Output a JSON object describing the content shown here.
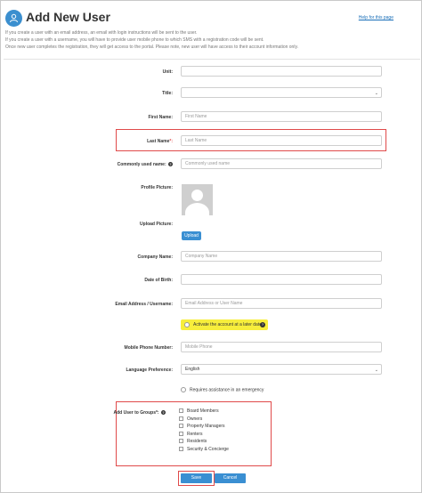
{
  "header": {
    "title": "Add New User",
    "help_link": "Help for this page",
    "intro_lines": [
      "If you create a user with an email address, an email with login instructions will be sent to the user.",
      "If you create a user with a username, you will have to provide user mobile phone to which SMS with a registration code will be sent.",
      "Once new user completes the registration, they will get access to the portal. Please note, new user will have access to their account information only."
    ]
  },
  "form": {
    "unit_label": "Unit:",
    "title_label": "Title:",
    "first_name_label": "First Name:",
    "first_name_placeholder": "First Name",
    "last_name_label": "Last Name",
    "last_name_required": "*:",
    "last_name_placeholder": "Last Name",
    "commonly_used_name_label": "Commonly used name:",
    "commonly_used_name_placeholder": "Commonly used name",
    "profile_picture_label": "Profile Picture:",
    "upload_picture_label": "Upload Picture:",
    "upload_button": "Upload",
    "company_name_label": "Company Name:",
    "company_name_placeholder": "Company Name",
    "date_of_birth_label": "Date of Birth:",
    "email_label": "Email Address / Username:",
    "email_placeholder": "Email Address or User Name",
    "activate_later_label": "Activate the account at a later date",
    "mobile_phone_label": "Mobile Phone Number:",
    "mobile_phone_placeholder": "Mobile Phone",
    "language_label": "Language Preference:",
    "language_value": "English",
    "assistance_label": "Requires assistance in an emergency",
    "groups_label": "Add User to Groups*:",
    "groups": [
      "Board Members",
      "Owners",
      "Property Managers",
      "Renters",
      "Residents",
      "Security & Concierge"
    ],
    "save_button": "Save",
    "cancel_button": "Cancel"
  },
  "colors": {
    "accent": "#3a8fd2",
    "highlight_border": "#e04a4a",
    "yellow_highlight": "#f7ee3c"
  }
}
